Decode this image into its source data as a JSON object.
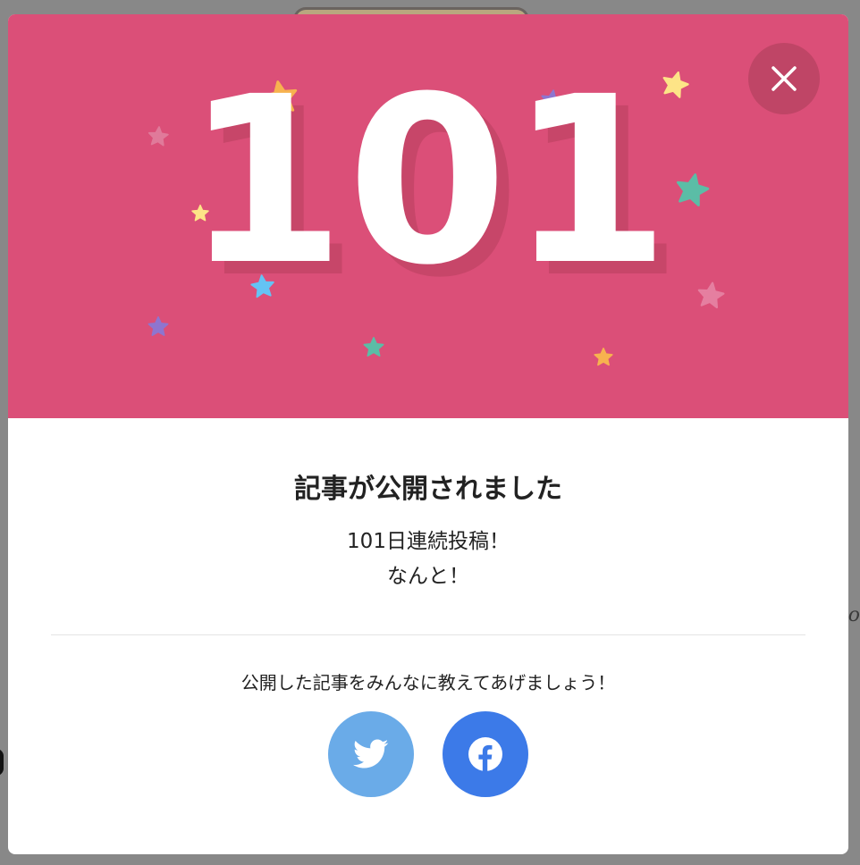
{
  "modal": {
    "hero": {
      "number": "101",
      "colors": {
        "background": "#db4f78",
        "number_shadow": "#c74669",
        "close_button": "#bf4566"
      },
      "stars": [
        {
          "color": "#f7b24f",
          "icon": "star-icon"
        },
        {
          "color": "#8e75cf",
          "icon": "star-icon"
        },
        {
          "color": "#fde487",
          "icon": "star-icon"
        },
        {
          "color": "#e07a9a",
          "icon": "star-icon"
        },
        {
          "color": "#fde487",
          "icon": "star-icon"
        },
        {
          "color": "#5bbda6",
          "icon": "star-icon"
        },
        {
          "color": "#64c3f4",
          "icon": "star-icon"
        },
        {
          "color": "#64c3f4",
          "icon": "star-icon"
        },
        {
          "color": "#e57fa0",
          "icon": "star-icon"
        },
        {
          "color": "#8e75cf",
          "icon": "star-icon"
        },
        {
          "color": "#5bbda6",
          "icon": "star-icon"
        },
        {
          "color": "#f7b24f",
          "icon": "star-icon"
        }
      ]
    },
    "close_icon": "close-icon",
    "title": "記事が公開されました",
    "streak_text": "101日連続投稿！",
    "exclaim_text": "なんと！",
    "share_message": "公開した記事をみんなに教えてあげましょう！",
    "share_buttons": [
      {
        "service": "Twitter",
        "icon": "twitter-icon",
        "color": "#6aabe8"
      },
      {
        "service": "Facebook",
        "icon": "facebook-icon",
        "color": "#3c7ae8"
      }
    ]
  },
  "background_peek_text": "to"
}
